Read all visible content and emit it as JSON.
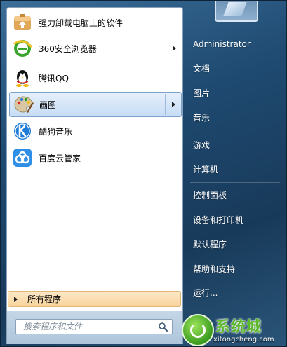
{
  "start_menu": {
    "programs": [
      {
        "label": "强力卸载电脑上的软件",
        "icon": "uninstall-icon",
        "has_submenu": false
      },
      {
        "label": "360安全浏览器",
        "icon": "360-browser-icon",
        "has_submenu": true
      },
      {
        "label": "腾讯QQ",
        "icon": "qq-penguin-icon",
        "has_submenu": false
      },
      {
        "label": "画图",
        "icon": "paint-palette-icon",
        "has_submenu": true,
        "highlighted": true
      },
      {
        "label": "酷狗音乐",
        "icon": "kugou-icon",
        "has_submenu": false
      },
      {
        "label": "百度云管家",
        "icon": "baidu-cloud-icon",
        "has_submenu": false
      }
    ],
    "all_programs_label": "所有程序",
    "search": {
      "placeholder": "搜索程序和文件"
    },
    "right_items": [
      {
        "label": "Administrator"
      },
      {
        "label": "文档"
      },
      {
        "label": "图片"
      },
      {
        "label": "音乐"
      },
      {
        "label": "游戏"
      },
      {
        "label": "计算机"
      },
      {
        "label": "控制面板"
      },
      {
        "label": "设备和打印机"
      },
      {
        "label": "默认程序"
      },
      {
        "label": "帮助和支持"
      },
      {
        "label": "运行..."
      }
    ],
    "watermark": {
      "title": "系统城",
      "url": "xitongcheng.com"
    }
  }
}
